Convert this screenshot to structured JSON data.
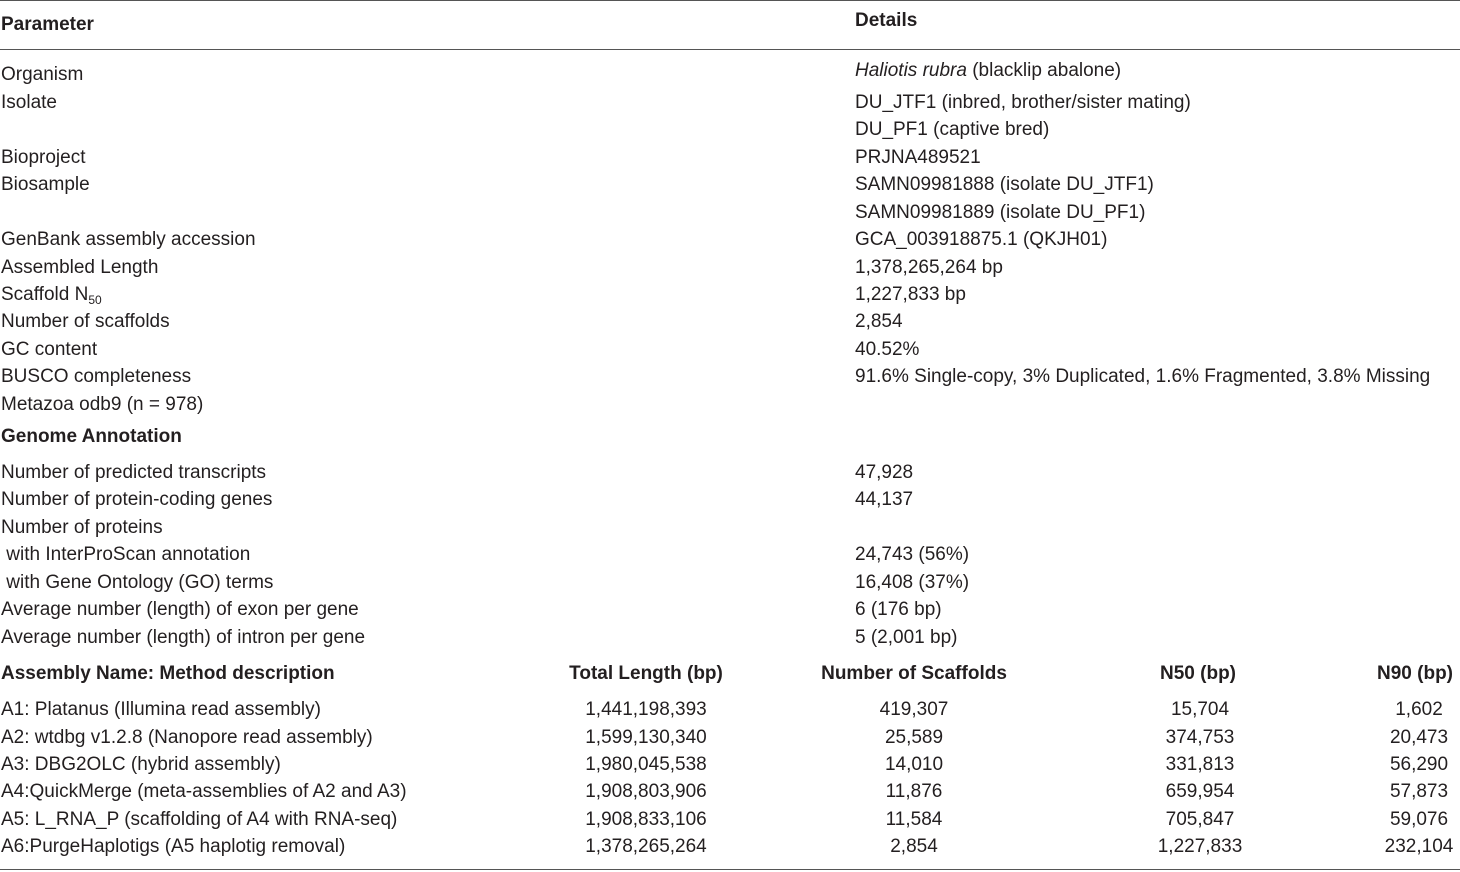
{
  "header": {
    "parameter": "Parameter",
    "details": "Details"
  },
  "params": [
    {
      "label": "Organism",
      "value_italic": "Haliotis rubra",
      "value": " (blacklip abalone)"
    },
    {
      "label": "Isolate",
      "value": "DU_JTF1 (inbred, brother/sister mating)"
    },
    {
      "label": "",
      "value": "DU_PF1 (captive bred)"
    },
    {
      "label": "Bioproject",
      "value": "PRJNA489521"
    },
    {
      "label": "Biosample",
      "value": "SAMN09981888 (isolate DU_JTF1)"
    },
    {
      "label": "",
      "value": "SAMN09981889 (isolate DU_PF1)"
    },
    {
      "label": "GenBank assembly accession",
      "value": "GCA_003918875.1 (QKJH01)"
    },
    {
      "label": "Assembled Length",
      "value": "1,378,265,264 bp"
    },
    {
      "label": "Scaffold N",
      "label_sub": "50",
      "value": "1,227,833 bp"
    },
    {
      "label": "Number of scaffolds",
      "value": "2,854"
    },
    {
      "label": "GC content",
      "value": "40.52%"
    },
    {
      "label": "BUSCO completeness",
      "value": "91.6% Single-copy, 3% Duplicated, 1.6% Fragmented, 3.8% Missing"
    },
    {
      "label": "Metazoa odb9 (n = 978)",
      "value": ""
    }
  ],
  "annotation": {
    "title": "Genome Annotation",
    "rows": [
      {
        "label": "Number of predicted transcripts",
        "value": "47,928"
      },
      {
        "label": "Number of protein-coding genes",
        "value": "44,137"
      },
      {
        "label": "Number of proteins",
        "value": ""
      },
      {
        "label": " with InterProScan annotation",
        "value": "24,743 (56%)"
      },
      {
        "label": " with Gene Ontology (GO) terms",
        "value": "16,408 (37%)"
      },
      {
        "label": "Average number (length) of exon per gene",
        "value": "6 (176 bp)"
      },
      {
        "label": "Average number (length) of intron per gene",
        "value": "5 (2,001 bp)"
      }
    ]
  },
  "assembly": {
    "headers": [
      "Assembly Name: Method description",
      "Total Length (bp)",
      "Number of Scaffolds",
      "N50 (bp)",
      "N90 (bp)"
    ],
    "rows": [
      [
        "A1: Platanus (Illumina read assembly)",
        "1,441,198,393",
        "419,307",
        "15,704",
        "1,602"
      ],
      [
        "A2: wtdbg v1.2.8 (Nanopore read assembly)",
        "1,599,130,340",
        "25,589",
        "374,753",
        "20,473"
      ],
      [
        "A3: DBG2OLC (hybrid assembly)",
        "1,980,045,538",
        "14,010",
        "331,813",
        "56,290"
      ],
      [
        "A4:QuickMerge (meta-assemblies of A2 and A3)",
        "1,908,803,906",
        "11,876",
        "659,954",
        "57,873"
      ],
      [
        "A5: L_RNA_P (scaffolding of A4 with RNA-seq)",
        "1,908,833,106",
        "11,584",
        "705,847",
        "59,076"
      ],
      [
        "A6:PurgeHaplotigs (A5 haplotig removal)",
        "1,378,265,264",
        "2,854",
        "1,227,833",
        "232,104"
      ]
    ]
  }
}
